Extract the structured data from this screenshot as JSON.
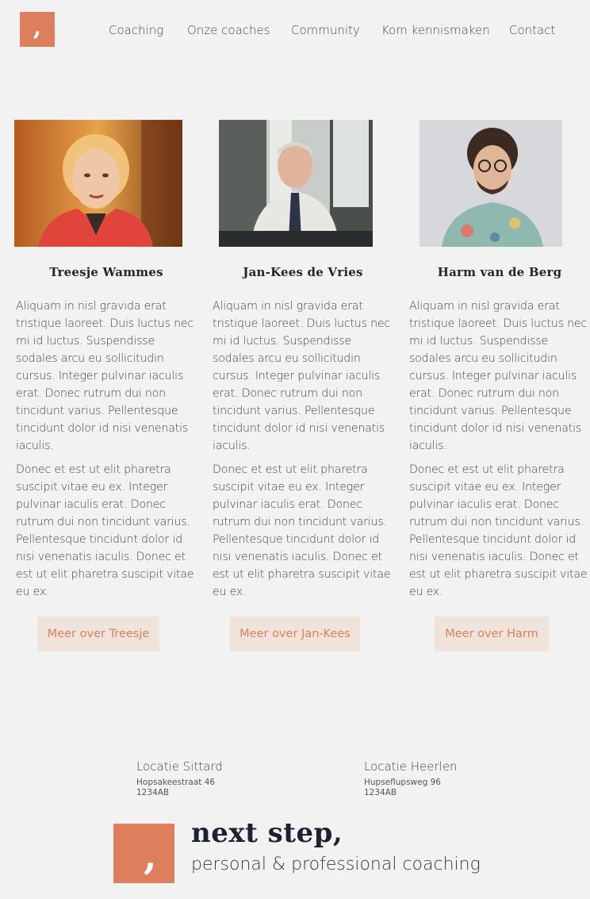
{
  "brand": {
    "logo_glyph": ",",
    "name": "next step,",
    "tagline": "personal & professional coaching",
    "accent_color": "#dd7f5c"
  },
  "nav": {
    "items": [
      {
        "label": "Coaching"
      },
      {
        "label": "Onze coaches"
      },
      {
        "label": "Community"
      },
      {
        "label": "Kom kennismaken"
      },
      {
        "label": "Contact"
      }
    ]
  },
  "coaches": [
    {
      "name": "Treesje Wammes",
      "photo": "woman-red-jacket-photo",
      "p1": "Aliquam in nisl gravida erat tristique laoreet. Duis luctus nec mi id luctus. Suspendisse sodales arcu eu sollicitudin cursus. Integer pulvinar iaculis erat. Donec rutrum dui non tincidunt varius. Pellentesque tincidunt dolor id nisi venenatis iaculis.",
      "p2": "Donec et est ut elit pharetra suscipit vitae eu ex. Integer pulvinar iaculis erat. Donec rutrum dui non tincidunt varius. Pellentesque tincidunt dolor id nisi venenatis iaculis. Donec et est ut elit pharetra suscipit vitae eu ex.",
      "button": "Meer over Treesje"
    },
    {
      "name": "Jan-Kees de Vries",
      "photo": "man-shirt-tie-photo",
      "p1": "Aliquam in nisl gravida erat tristique laoreet. Duis luctus nec mi id luctus. Suspendisse sodales arcu eu sollicitudin cursus. Integer pulvinar iaculis erat. Donec rutrum dui non tincidunt varius. Pellentesque tincidunt dolor id nisi venenatis iaculis.",
      "p2": "Donec et est ut elit pharetra suscipit vitae eu ex. Integer pulvinar iaculis erat. Donec rutrum dui non tincidunt varius. Pellentesque tincidunt dolor id nisi venenatis iaculis. Donec et est ut elit pharetra suscipit vitae eu ex.",
      "button": "Meer over Jan-Kees"
    },
    {
      "name": "Harm van de Berg",
      "photo": "man-curly-hair-glasses-photo",
      "p1": "Aliquam in nisl gravida erat tristique laoreet. Duis luctus nec mi id luctus. Suspendisse sodales arcu eu sollicitudin cursus. Integer pulvinar iaculis erat. Donec rutrum dui non tincidunt varius. Pellentesque tincidunt dolor id nisi venenatis iaculis.",
      "p2": "Donec et est ut elit pharetra suscipit vitae eu ex. Integer pulvinar iaculis erat. Donec rutrum dui non tincidunt varius. Pellentesque tincidunt dolor id nisi venenatis iaculis. Donec et est ut elit pharetra suscipit vitae eu ex.",
      "button": "Meer over Harm"
    }
  ],
  "locations": [
    {
      "title": "Locatie Sittard",
      "street": "Hopsakeestraat 46",
      "postcode": "1234AB"
    },
    {
      "title": "Locatie Heerlen",
      "street": "Hupseflupsweg 96",
      "postcode": "1234AB"
    }
  ]
}
